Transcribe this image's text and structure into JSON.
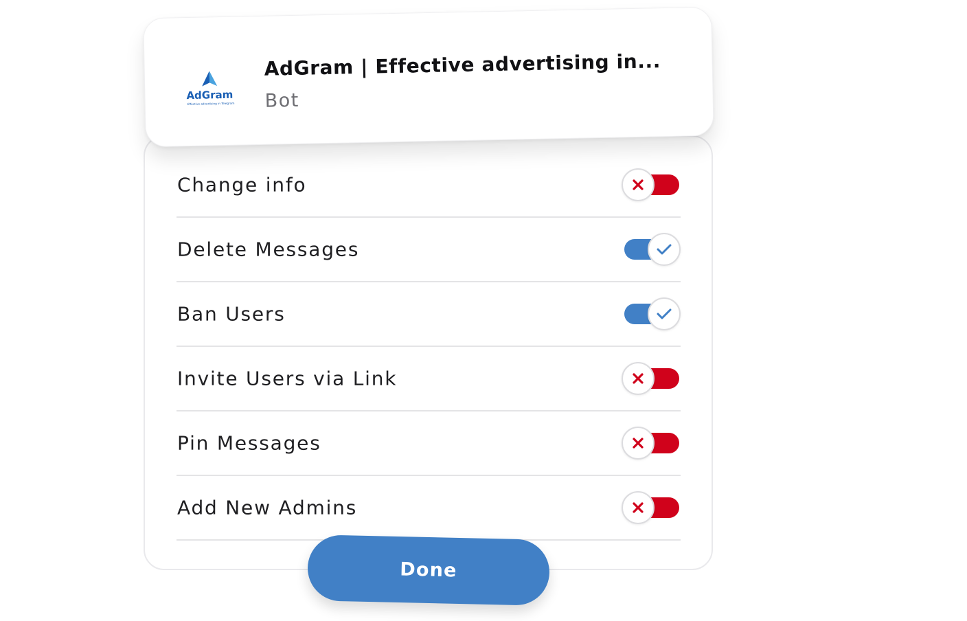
{
  "header": {
    "bot_name": "AdGram | Effective advertising in...",
    "bot_type": "Bot",
    "logo": {
      "icon": "adgram-logo-icon",
      "wordmark": "AdGram",
      "tagline": "Effective advertising in Telegram",
      "colors": {
        "primary": "#1a5fb4",
        "light": "#4aa3df"
      }
    }
  },
  "permissions": [
    {
      "label": "Change info",
      "enabled": false
    },
    {
      "label": "Delete Messages",
      "enabled": true
    },
    {
      "label": "Ban Users",
      "enabled": true
    },
    {
      "label": "Invite Users via Link",
      "enabled": false
    },
    {
      "label": "Pin Messages",
      "enabled": false
    },
    {
      "label": "Add New Admins",
      "enabled": false
    }
  ],
  "done_button": {
    "label": "Done"
  },
  "icons": {
    "on": "check-icon",
    "off": "close-icon"
  },
  "colors": {
    "accent": "#4180c6",
    "off_red": "#d0021b",
    "divider": "#e4e4e6",
    "text": "#1f1f22",
    "muted": "#6e6e73"
  }
}
